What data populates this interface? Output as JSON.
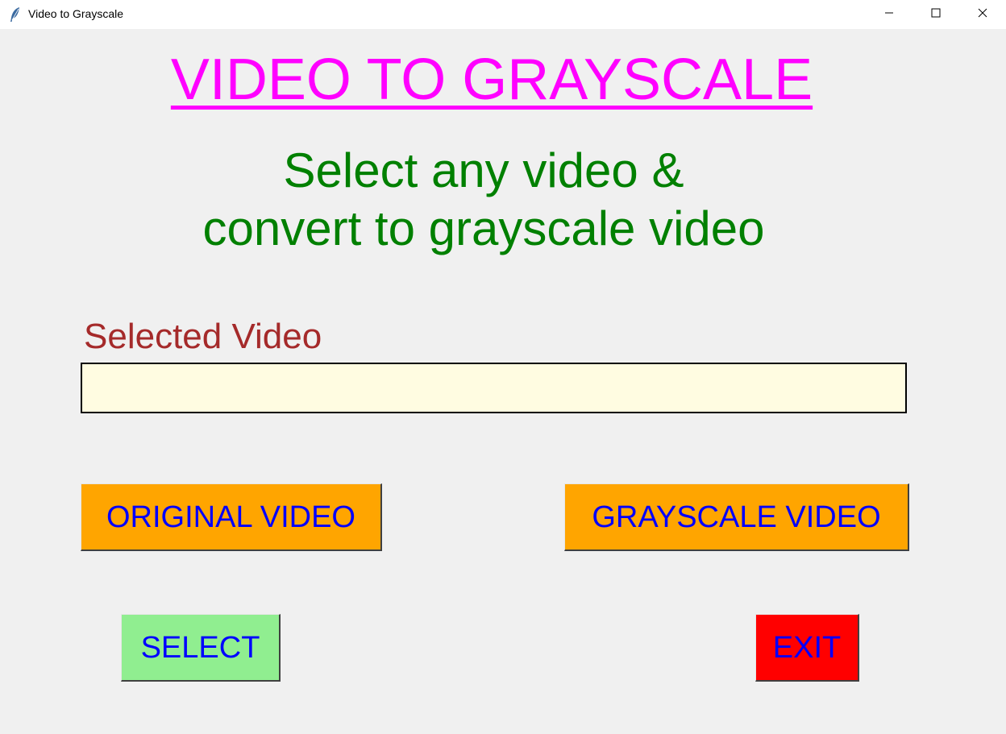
{
  "window": {
    "title": "Video to Grayscale",
    "minimize_icon": "minimize-icon",
    "maximize_icon": "maximize-icon",
    "close_icon": "close-icon",
    "app_icon": "feather-icon"
  },
  "main": {
    "title": "VIDEO TO GRAYSCALE",
    "subtitle_line1": "Select any video &",
    "subtitle_line2": "convert to grayscale video",
    "selected_label": "Selected Video",
    "selected_value": ""
  },
  "buttons": {
    "original": "ORIGINAL VIDEO",
    "grayscale": "GRAYSCALE VIDEO",
    "select": "SELECT",
    "exit": "EXIT"
  },
  "colors": {
    "title": "#ff00ff",
    "subtitle": "#008000",
    "label": "#a52a2a",
    "field_bg": "#fffce1",
    "button_text": "#0000ff",
    "original_bg": "#ffa500",
    "grayscale_bg": "#ffa500",
    "select_bg": "#90ee90",
    "exit_bg": "#ff0000"
  }
}
